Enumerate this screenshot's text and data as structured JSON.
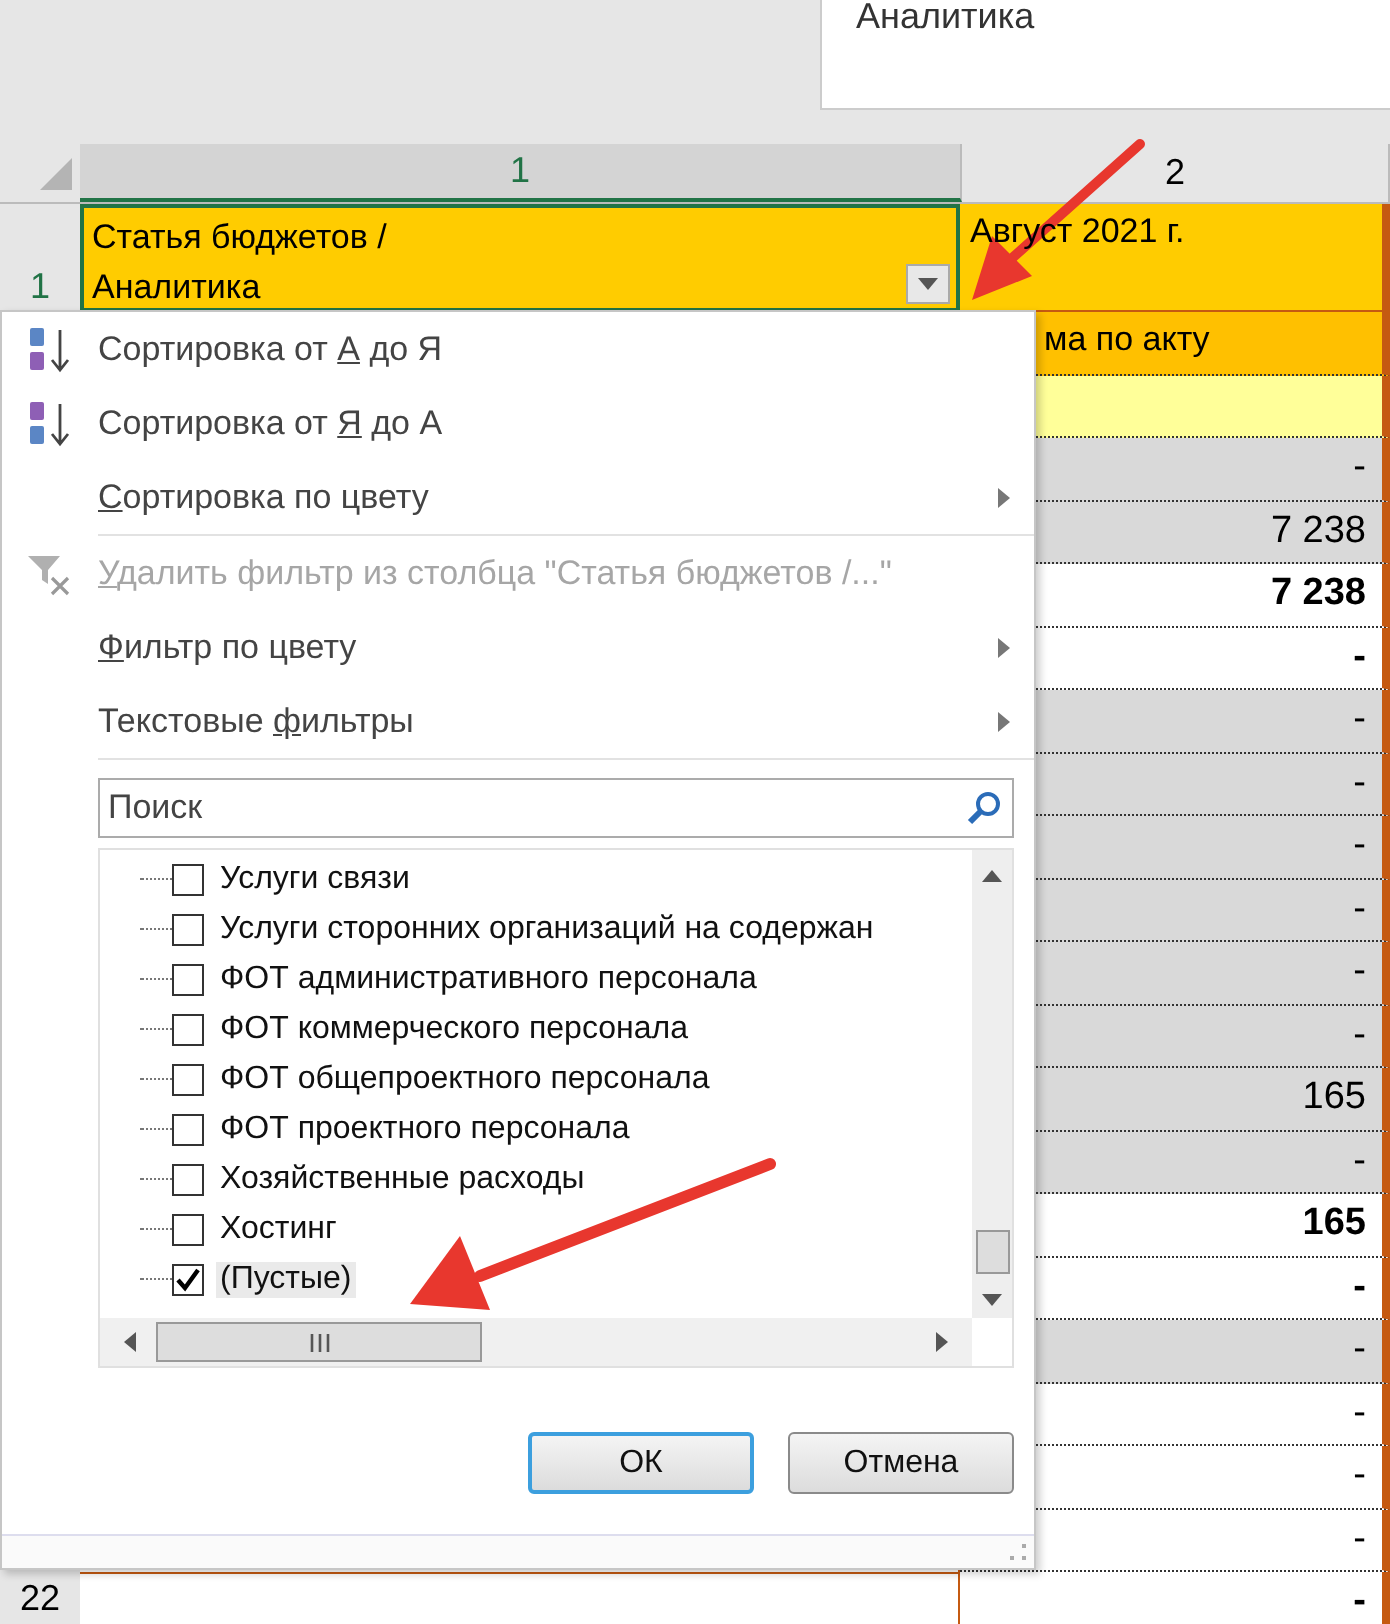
{
  "text_box": {
    "text": "Аналитика"
  },
  "column_headers": [
    {
      "label": "1",
      "selected": true
    },
    {
      "label": "2",
      "selected": false
    }
  ],
  "header_row": {
    "row_number": "1",
    "cell_1": "Статья бюджетов /\nАналитика",
    "cell_2": "Август 2021 г."
  },
  "rows": [
    {
      "value": "ма по акту",
      "color": "#ffc000",
      "bold": false
    },
    {
      "color": "#ffff99"
    },
    {
      "value": "-",
      "color": "#d9d9d9",
      "bold": false
    },
    {
      "value": "7 238",
      "color": "#d9d9d9",
      "bold": false
    },
    {
      "value": "7 238",
      "color": "#ffffff",
      "bold": true
    },
    {
      "value": "-",
      "color": "#ffffff",
      "bold": true
    },
    {
      "value": "-",
      "color": "#d9d9d9",
      "bold": false
    },
    {
      "value": "-",
      "color": "#d9d9d9",
      "bold": false
    },
    {
      "value": "-",
      "color": "#d9d9d9",
      "bold": false
    },
    {
      "value": "-",
      "color": "#d9d9d9",
      "bold": false
    },
    {
      "value": "-",
      "color": "#d9d9d9",
      "bold": false
    },
    {
      "value": "-",
      "color": "#d9d9d9",
      "bold": false
    },
    {
      "value": "165",
      "color": "#d9d9d9",
      "bold": false
    },
    {
      "value": "-",
      "color": "#d9d9d9",
      "bold": false
    },
    {
      "value": "165",
      "color": "#ffffff",
      "bold": true
    },
    {
      "value": "-",
      "color": "#ffffff",
      "bold": true
    },
    {
      "value": "-",
      "color": "#d9d9d9",
      "bold": false
    },
    {
      "value": "-",
      "color": "#ffffff",
      "bold": false
    },
    {
      "value": "-",
      "color": "#ffffff",
      "bold": false
    },
    {
      "value": "-",
      "color": "#ffffff",
      "bold": false
    },
    {
      "value": "-",
      "color": "#ffffff",
      "bold": true,
      "row_number": "22"
    }
  ],
  "filter_menu": {
    "items": [
      {
        "kind": "sort_az",
        "before": "Сортировка от ",
        "key": "А",
        "after": " до Я",
        "disabled": false
      },
      {
        "kind": "sort_za",
        "before": "Сортировка от ",
        "key": "Я",
        "after": " до А",
        "disabled": false
      },
      {
        "kind": "submenu",
        "key": "С",
        "after": "ортировка по цвету",
        "disabled": false
      },
      {
        "kind": "separator"
      },
      {
        "kind": "clear_filter",
        "key": "У",
        "after": "далить фильтр из столбца \"Статья бюджетов /...\"",
        "disabled": true
      },
      {
        "kind": "submenu",
        "key": "Ф",
        "after": "ильтр по цвету",
        "disabled": false
      },
      {
        "kind": "submenu",
        "before": "Текстовые ",
        "key": "ф",
        "after": "ильтры",
        "disabled": false
      },
      {
        "kind": "separator"
      }
    ],
    "search": {
      "placeholder": "Поиск"
    },
    "values": [
      {
        "label": "Услуги связи",
        "checked": false,
        "selected": false
      },
      {
        "label": "Услуги сторонних организаций на содержан",
        "checked": false,
        "selected": false
      },
      {
        "label": "ФОТ административного персонала",
        "checked": false,
        "selected": false
      },
      {
        "label": "ФОТ коммерческого персонала",
        "checked": false,
        "selected": false
      },
      {
        "label": "ФОТ общепроектного персонала",
        "checked": false,
        "selected": false
      },
      {
        "label": "ФОТ проектного персонала",
        "checked": false,
        "selected": false
      },
      {
        "label": "Хозяйственные расходы",
        "checked": false,
        "selected": false
      },
      {
        "label": "Хостинг",
        "checked": false,
        "selected": false
      },
      {
        "label": "(Пустые)",
        "checked": true,
        "selected": true
      }
    ],
    "buttons": [
      {
        "label": "ОК",
        "focused": true
      },
      {
        "label": "Отмена",
        "focused": false
      }
    ]
  }
}
